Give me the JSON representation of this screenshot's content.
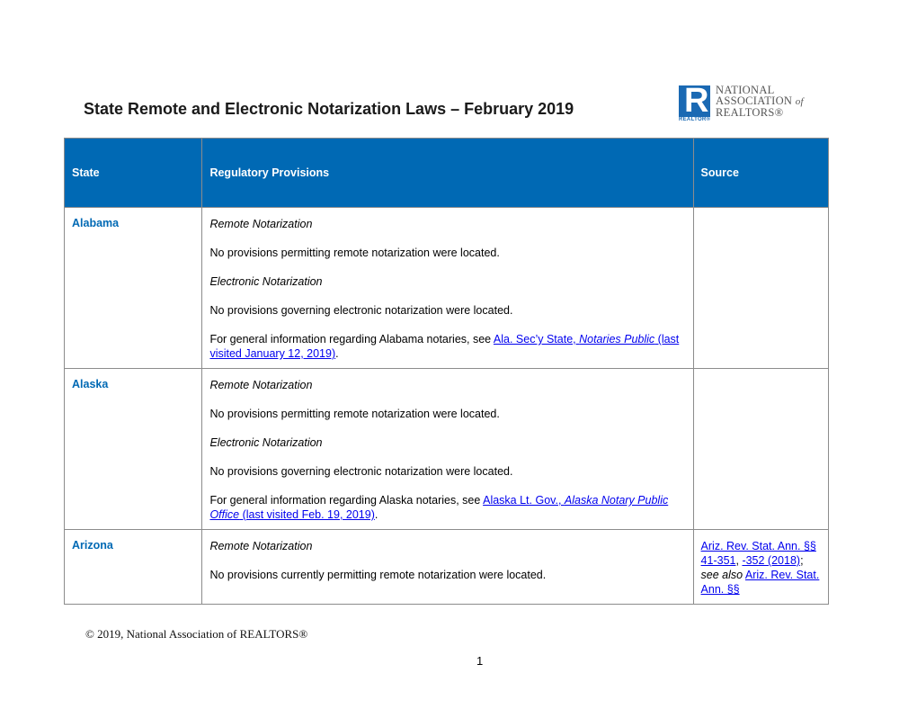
{
  "document": {
    "title": "State Remote and Electronic Notarization Laws – February 2019",
    "logo": {
      "letter": "R",
      "tag": "REALTOR®",
      "line1": "NATIONAL",
      "line2": "ASSOCIATION",
      "line2_suffix": "of",
      "line3": "REALTORS®"
    },
    "colors": {
      "header_bg": "#0069b4",
      "state_text": "#0069b4",
      "link": "#0000ee"
    },
    "table": {
      "headers": [
        "State",
        "Regulatory Provisions",
        "Source"
      ],
      "rows": [
        {
          "state": "Alabama",
          "remote_heading": "Remote Notarization",
          "remote_text": "No provisions permitting remote notarization were located.",
          "electronic_heading": "Electronic Notarization",
          "electronic_text": "No provisions governing electronic notarization were located.",
          "general_prefix": "For general information regarding Alabama notaries, see ",
          "link_a": "Ala. Sec’y State, ",
          "link_italic": "Notaries Public",
          "link_b": " (last visited January 12, 2019)",
          "general_suffix": ".",
          "source": ""
        },
        {
          "state": "Alaska",
          "remote_heading": "Remote Notarization",
          "remote_text": "No provisions permitting remote notarization were located.",
          "electronic_heading": "Electronic Notarization",
          "electronic_text": "No provisions governing electronic notarization were located.",
          "general_prefix": "For general information regarding Alaska notaries, see ",
          "link_a": "Alaska Lt. Gov., ",
          "link_italic": "Alaska Notary Public Office",
          "link_b": " (last visited Feb. 19, 2019)",
          "general_suffix": ".",
          "source": ""
        },
        {
          "state": "Arizona",
          "remote_heading": "Remote Notarization",
          "remote_text": "No provisions currently permitting remote notarization were located.",
          "source_parts": {
            "link1": "Ariz. Rev. Stat. Ann. §§ 41-351",
            "sep1": ", ",
            "link2": "-352 (2018)",
            "sep2": "; ",
            "see_also": "see also",
            "sep3": " ",
            "link3": "Ariz. Rev. Stat. Ann. §§"
          }
        }
      ]
    },
    "footer": {
      "copyright": "© 2019, National Association of REALTORS®",
      "page_number": "1"
    }
  }
}
